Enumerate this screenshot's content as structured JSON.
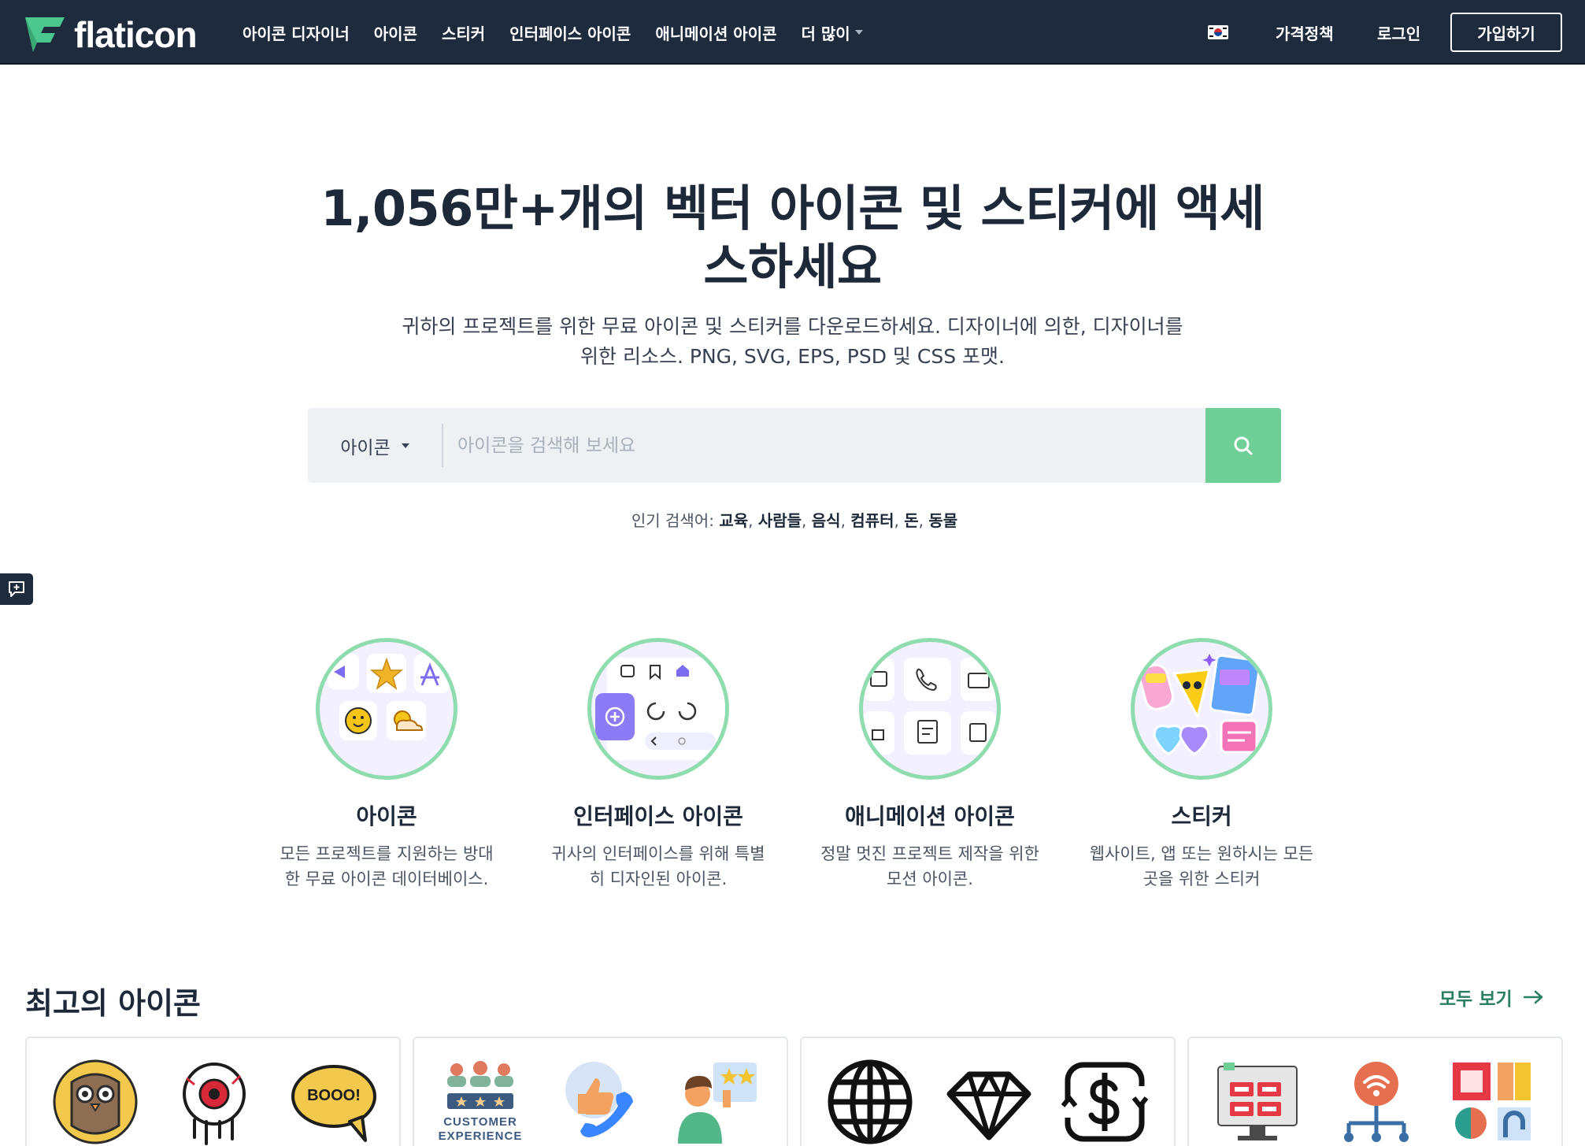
{
  "nav": {
    "logo_text": "flaticon",
    "links": [
      "아이콘 디자이너",
      "아이콘",
      "스티커",
      "인터페이스 아이콘",
      "애니메이션 아이콘"
    ],
    "more_label": "더 많이",
    "flag_icon": "korea-flag-icon",
    "pricing_label": "가격정책",
    "login_label": "로그인",
    "signup_label": "가입하기"
  },
  "hero": {
    "title_line1": "1,056만+개의 벡터 아이콘 및 스티커에 액세",
    "title_line2": "스하세요",
    "subtitle_line1": "귀하의 프로젝트를 위한 무료 아이콘 및 스티커를 다운로드하세요. 디자이너에 의한, 디자이너를",
    "subtitle_line2": "위한 리소스. PNG, SVG, EPS, PSD 및 CSS 포맷."
  },
  "search": {
    "type_label": "아이콘",
    "placeholder": "아이콘을 검색해 보세요",
    "button_icon": "search-icon"
  },
  "popular": {
    "label": "인기 검색어:",
    "terms": [
      "교육",
      "사람들",
      "음식",
      "컴퓨터",
      "돈",
      "동물"
    ]
  },
  "categories": [
    {
      "title": "아이콘",
      "desc_line1": "모든 프로젝트를 지원하는 방대",
      "desc_line2": "한 무료 아이콘 데이터베이스."
    },
    {
      "title": "인터페이스 아이콘",
      "desc_line1": "귀사의 인터페이스를 위해 특별",
      "desc_line2": "히 디자인된 아이콘."
    },
    {
      "title": "애니메이션 아이콘",
      "desc_line1": "정말 멋진 프로젝트 제작을 위한",
      "desc_line2": "모션 아이콘."
    },
    {
      "title": "스티커",
      "desc_line1": "웹사이트, 앱 또는 원하시는 모든",
      "desc_line2": "곳을 위한 스티커"
    }
  ],
  "best": {
    "title": "최고의 아이콘",
    "see_all_label": "모두 보기",
    "boo_text": "BOOO!",
    "cx_line1": "CUSTOMER",
    "cx_line2": "EXPERIENCE"
  },
  "colors": {
    "nav_bg": "#1d2b3d",
    "accent_green": "#6fcf97",
    "link_green": "#2a7f62"
  }
}
